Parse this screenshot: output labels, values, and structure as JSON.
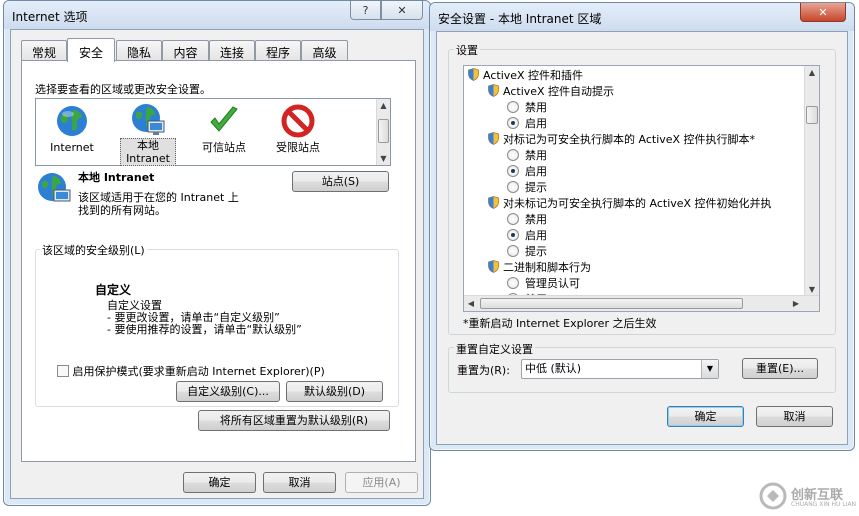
{
  "left_window": {
    "title": "Internet 选项",
    "help_label": "?",
    "close_label": "✕",
    "tabs": [
      "常规",
      "安全",
      "隐私",
      "内容",
      "连接",
      "程序",
      "高级"
    ],
    "prompt": "选择要查看的区域或更改安全设置。",
    "zones": [
      {
        "label": "Internet",
        "icon": "globe-icon"
      },
      {
        "label": "本地\nIntranet",
        "icon": "intranet-globe-icon"
      },
      {
        "label": "可信站点",
        "icon": "checkmark-icon"
      },
      {
        "label": "受限站点",
        "icon": "forbidden-icon"
      }
    ],
    "zone_title": "本地 Intranet",
    "zone_desc_1": "该区域适用于在您的 Intranet 上",
    "zone_desc_2": "找到的所有网站。",
    "sites_button": "站点(S)",
    "level_group_label": "该区域的安全级别(L)",
    "level_title": "自定义",
    "level_line_1": "自定义设置",
    "level_line_2": "- 要更改设置，请单击“自定义级别”",
    "level_line_3": "- 要使用推荐的设置，请单击“默认级别”",
    "protected_mode_label": "启用保护模式(要求重新启动 Internet Explorer)(P)",
    "custom_level_button": "自定义级别(C)...",
    "default_level_button": "默认级别(D)",
    "reset_all_button": "将所有区域重置为默认级别(R)",
    "ok_button": "确定",
    "cancel_button": "取消",
    "apply_button": "应用(A)"
  },
  "right_window": {
    "title": "安全设置 - 本地 Intranet 区域",
    "close_label": "✕",
    "settings_label": "设置",
    "tree": [
      {
        "type": "category",
        "label": "ActiveX 控件和插件",
        "indent": 0
      },
      {
        "type": "setting",
        "label": "ActiveX 控件自动提示",
        "indent": 1
      },
      {
        "type": "radio",
        "label": "禁用",
        "checked": false
      },
      {
        "type": "radio",
        "label": "启用",
        "checked": true
      },
      {
        "type": "setting",
        "label": "对标记为可安全执行脚本的 ActiveX 控件执行脚本*",
        "indent": 1
      },
      {
        "type": "radio",
        "label": "禁用",
        "checked": false
      },
      {
        "type": "radio",
        "label": "启用",
        "checked": true
      },
      {
        "type": "radio",
        "label": "提示",
        "checked": false
      },
      {
        "type": "setting",
        "label": "对未标记为可安全执行脚本的 ActiveX 控件初始化并执",
        "indent": 1
      },
      {
        "type": "radio",
        "label": "禁用",
        "checked": false
      },
      {
        "type": "radio",
        "label": "启用",
        "checked": true
      },
      {
        "type": "radio",
        "label": "提示",
        "checked": false
      },
      {
        "type": "setting",
        "label": "二进制和脚本行为",
        "indent": 1
      },
      {
        "type": "radio",
        "label": "管理员认可",
        "checked": false
      },
      {
        "type": "radio",
        "label": "禁用",
        "checked": false
      }
    ],
    "restart_note": "*重新启动 Internet Explorer 之后生效",
    "reset_group_label": "重置自定义设置",
    "reset_to_label": "重置为(R):",
    "reset_to_value": "中低 (默认)",
    "reset_button": "重置(E)...",
    "ok_button": "确定",
    "cancel_button": "取消"
  },
  "watermark": {
    "text": "创新互联",
    "subtext": "CHUANG XIN HU LIAN"
  }
}
